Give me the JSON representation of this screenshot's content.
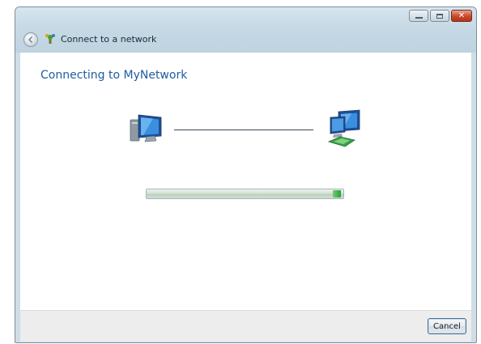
{
  "window": {
    "title": "Connect to a network",
    "controls": {
      "minimize_icon": "minimize-icon",
      "maximize_icon": "maximize-icon",
      "close_glyph": "✕"
    },
    "title_icon": "network-connect-icon",
    "back_icon": "back-arrow-icon"
  },
  "main": {
    "heading": "Connecting to MyNetwork",
    "left_icon": "computer-icon",
    "right_icon": "network-icon",
    "progress": {
      "fraction": 1.0
    }
  },
  "footer": {
    "cancel_label": "Cancel"
  },
  "colors": {
    "heading": "#1f5da0",
    "progress_accent": "#24a332",
    "close_button": "#c7482b"
  }
}
